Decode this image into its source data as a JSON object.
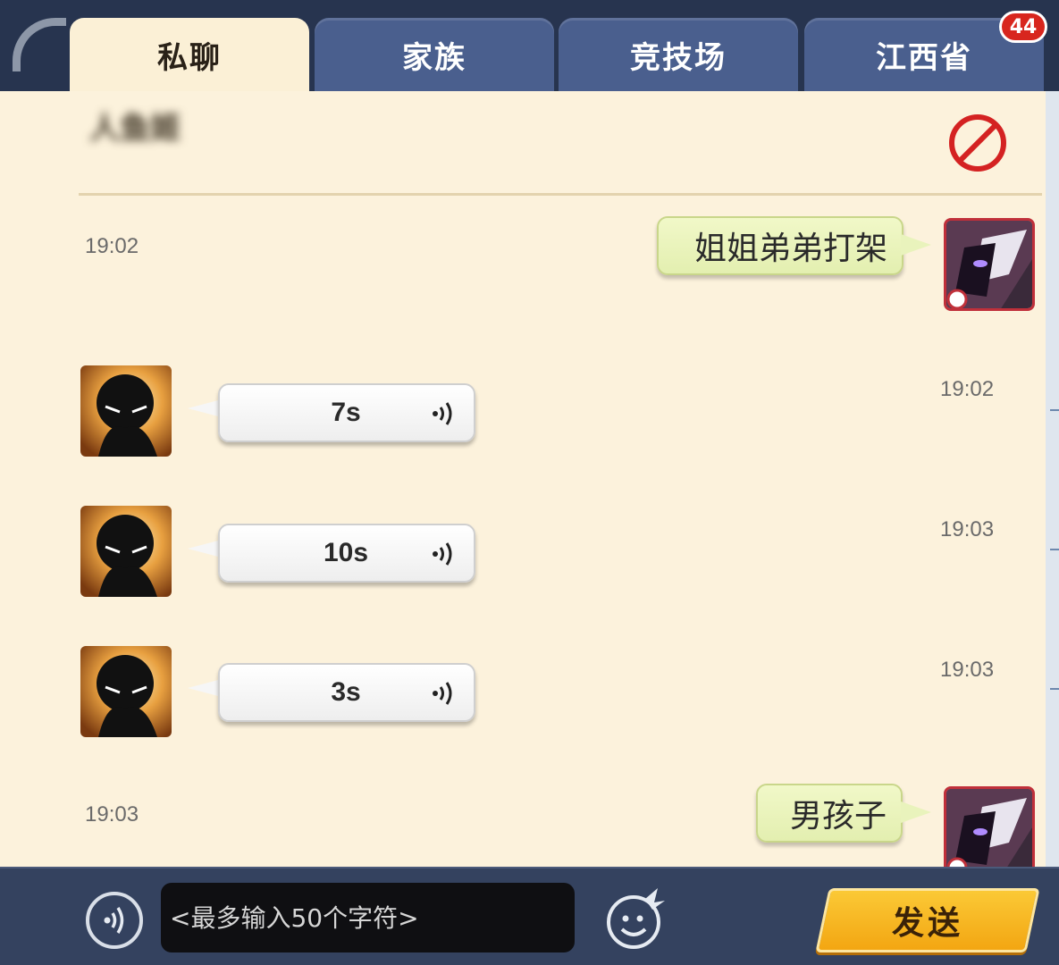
{
  "tabs": [
    {
      "label": "私聊",
      "active": true
    },
    {
      "label": "家族",
      "active": false
    },
    {
      "label": "竞技场",
      "active": false
    },
    {
      "label": "江西省",
      "active": false
    }
  ],
  "tab_badge": "44",
  "conversation": {
    "contact_name": "人鱼姬",
    "block_icon": "block-icon"
  },
  "messages": [
    {
      "from": "self",
      "type": "text",
      "text": "姐姐弟弟打架",
      "time": "19:02"
    },
    {
      "from": "other",
      "type": "voice",
      "duration": "7s",
      "time": "19:02"
    },
    {
      "from": "other",
      "type": "voice",
      "duration": "10s",
      "time": "19:03"
    },
    {
      "from": "other",
      "type": "voice",
      "duration": "3s",
      "time": "19:03"
    },
    {
      "from": "self",
      "type": "text",
      "text": "男孩子",
      "time": "19:03"
    }
  ],
  "input": {
    "placeholder": "<最多输入50个字符>",
    "value": ""
  },
  "send_label": "发送",
  "colors": {
    "panel_bg": "#fcf2dc",
    "tab_inactive": "#4a5f8e",
    "tab_active": "#fbf0d6",
    "self_bubble": "#e9f3bc",
    "other_bubble": "#ffffff",
    "send_button": "#f7b620",
    "badge": "#d8261e",
    "block_icon": "#d42222"
  }
}
